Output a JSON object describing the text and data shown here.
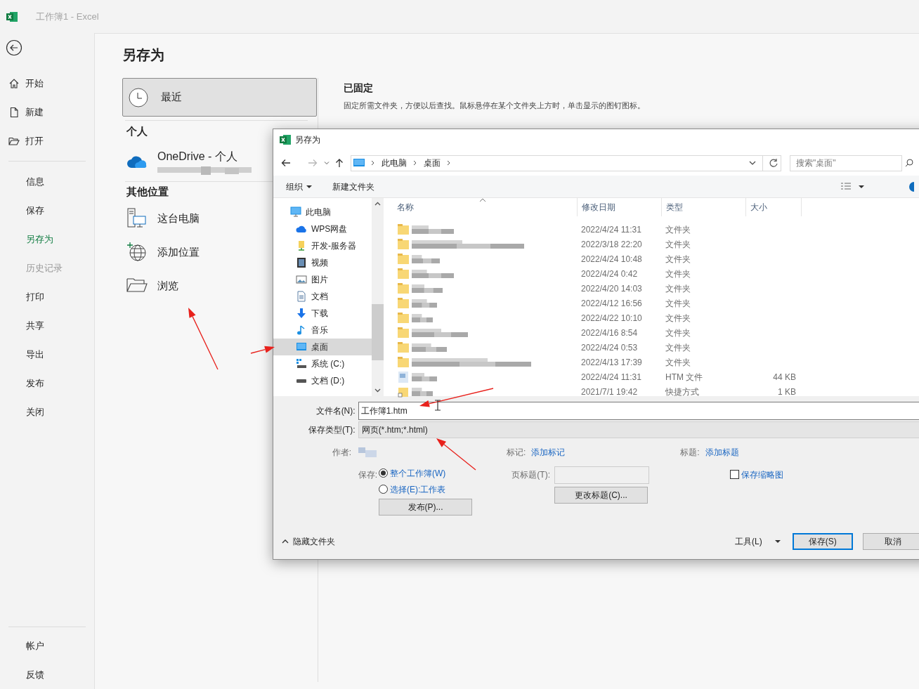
{
  "window": {
    "title": "工作簿1 - Excel"
  },
  "nav": {
    "items": [
      {
        "label": "开始",
        "kind": "home",
        "selected": false,
        "disabled": false
      },
      {
        "label": "新建",
        "kind": "new",
        "selected": false,
        "disabled": false
      },
      {
        "label": "打开",
        "kind": "open",
        "selected": false,
        "disabled": false
      },
      {
        "label": "信息",
        "kind": "text",
        "selected": false,
        "disabled": false
      },
      {
        "label": "保存",
        "kind": "text",
        "selected": false,
        "disabled": false
      },
      {
        "label": "另存为",
        "kind": "text",
        "selected": true,
        "disabled": false
      },
      {
        "label": "历史记录",
        "kind": "text",
        "selected": false,
        "disabled": true
      },
      {
        "label": "打印",
        "kind": "text",
        "selected": false,
        "disabled": false
      },
      {
        "label": "共享",
        "kind": "text",
        "selected": false,
        "disabled": false
      },
      {
        "label": "导出",
        "kind": "text",
        "selected": false,
        "disabled": false
      },
      {
        "label": "发布",
        "kind": "text",
        "selected": false,
        "disabled": false
      },
      {
        "label": "关闭",
        "kind": "text",
        "selected": false,
        "disabled": false
      }
    ],
    "bottom_items": [
      "帐户",
      "反馈"
    ]
  },
  "page_title": "另存为",
  "locations": {
    "recent": {
      "label": "最近",
      "selected": true
    },
    "personal_header": "个人",
    "onedrive": {
      "label": "OneDrive - 个人"
    },
    "other_header": "其他位置",
    "others": [
      {
        "label": "这台电脑",
        "kind": "pc"
      },
      {
        "label": "添加位置",
        "kind": "globe"
      },
      {
        "label": "浏览",
        "kind": "folder"
      }
    ]
  },
  "pinned": {
    "title": "已固定",
    "description": "固定所需文件夹，方便以后查找。鼠标悬停在某个文件夹上方时，单击显示的图钉图标。"
  },
  "dialog": {
    "title": "另存为",
    "breadcrumb": [
      "此电脑",
      "桌面"
    ],
    "search_placeholder": "搜索\"桌面\"",
    "toolbar": [
      "组织",
      "新建文件夹"
    ],
    "tree": [
      {
        "label": "此电脑",
        "kind": "computer",
        "selected": false
      },
      {
        "label": "WPS网盘",
        "kind": "cloud",
        "selected": false
      },
      {
        "label": "开发-服务器",
        "kind": "server",
        "selected": false
      },
      {
        "label": "视频",
        "kind": "video",
        "selected": false
      },
      {
        "label": "图片",
        "kind": "pictures",
        "selected": false
      },
      {
        "label": "文档",
        "kind": "documents",
        "selected": false
      },
      {
        "label": "下载",
        "kind": "downloads",
        "selected": false
      },
      {
        "label": "音乐",
        "kind": "music",
        "selected": false
      },
      {
        "label": "桌面",
        "kind": "desktop",
        "selected": true
      },
      {
        "label": "系统 (C:)",
        "kind": "drive-c",
        "selected": false
      },
      {
        "label": "文档 (D:)",
        "kind": "drive",
        "selected": false
      }
    ],
    "columns": [
      "名称",
      "修改日期",
      "类型",
      "大小"
    ],
    "rows": [
      {
        "kind": "folder",
        "date": "2022/4/24 11:31",
        "type": "文件夹"
      },
      {
        "kind": "folder",
        "date": "2022/3/18 22:20",
        "type": "文件夹"
      },
      {
        "kind": "folder",
        "date": "2022/4/24 10:48",
        "type": "文件夹"
      },
      {
        "kind": "folder",
        "date": "2022/4/24 0:42",
        "type": "文件夹"
      },
      {
        "kind": "folder",
        "date": "2022/4/20 14:03",
        "type": "文件夹"
      },
      {
        "kind": "folder",
        "date": "2022/4/12 16:56",
        "type": "文件夹"
      },
      {
        "kind": "folder",
        "date": "2022/4/22 10:10",
        "type": "文件夹"
      },
      {
        "kind": "folder",
        "date": "2022/4/16 8:54",
        "type": "文件夹"
      },
      {
        "kind": "folder",
        "date": "2022/4/24 0:53",
        "type": "文件夹"
      },
      {
        "kind": "folder",
        "date": "2022/4/13 17:39",
        "type": "文件夹"
      },
      {
        "kind": "htm",
        "date": "2022/4/24 11:31",
        "type": "HTM 文件",
        "size": "44 KB"
      },
      {
        "kind": "shortcut",
        "date": "2021/7/1 19:42",
        "type": "快捷方式",
        "size": "1 KB"
      }
    ],
    "filename_label": "文件名(N):",
    "filename": "工作簿1.htm",
    "type_label": "保存类型(T):",
    "type_value": "网页(*.htm;*.html)",
    "author_label": "作者:",
    "tags_label": "标记:",
    "tags_link": "添加标记",
    "title_label": "标题:",
    "title_link": "添加标题",
    "save_label": "保存:",
    "save_options": [
      {
        "label": "整个工作簿(W)",
        "selected": true
      },
      {
        "label": "选择(E):工作表",
        "selected": false
      }
    ],
    "publish_button": "发布(P)...",
    "page_title_label": "页标题(T):",
    "change_title_button": "更改标题(C)...",
    "thumbnail": {
      "label": "保存缩略图",
      "checked": false
    },
    "hide_folders": "隐藏文件夹",
    "tools": "工具(L)",
    "save_button": "保存(S)",
    "cancel_button": "取消"
  }
}
